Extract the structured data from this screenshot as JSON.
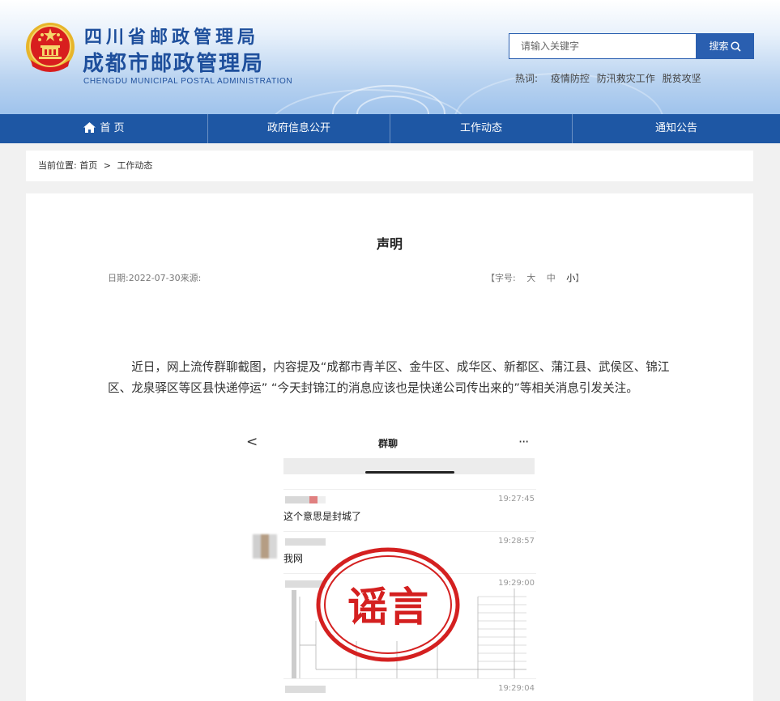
{
  "header": {
    "title_line1": "四川省邮政管理局",
    "title_line2": "成都市邮政管理局",
    "title_en": "CHENGDU  MUNICIPAL POSTAL ADMINISTRATION",
    "search_placeholder": "请输入关键字",
    "search_button": "搜索",
    "hotwords_label": "热词:",
    "hotwords": [
      "疫情防控",
      "防汛救灾工作",
      "脱贫攻坚"
    ],
    "brand_color": "#1e57a4"
  },
  "nav": {
    "items": [
      {
        "label": "首 页",
        "icon": "home-icon"
      },
      {
        "label": "政府信息公开"
      },
      {
        "label": "工作动态"
      },
      {
        "label": "通知公告"
      }
    ]
  },
  "breadcrumb": {
    "prefix": "当前位置:",
    "items": [
      "首页",
      "工作动态"
    ],
    "separator": ">"
  },
  "article": {
    "title": "声明",
    "date_label": "日期:",
    "date": "2022-07-30",
    "source_label": "来源:",
    "source": "",
    "fontsize_label": "【字号:",
    "fontsize_options": [
      "大",
      "中",
      "小"
    ],
    "fontsize_close": "】",
    "body": "近日，网上流传群聊截图，内容提及“成都市青羊区、金牛区、成华区、新都区、蒲江县、武侯区、锦江区、龙泉驿区等区县快递停运” “今天封锦江的消息应该也是快递公司传出来的”等相关消息引发关注。"
  },
  "screenshot": {
    "back": "<",
    "title": "群聊",
    "more": "···",
    "messages": [
      {
        "time": "19:27:45",
        "text": "这个意思是封城了"
      },
      {
        "time": "19:28:57",
        "text": "我网"
      },
      {
        "time": "19:29:00",
        "text": ""
      },
      {
        "time": "19:29:04",
        "text": ""
      }
    ],
    "stamp_text": "谣言",
    "stamp_color": "#d42020"
  }
}
